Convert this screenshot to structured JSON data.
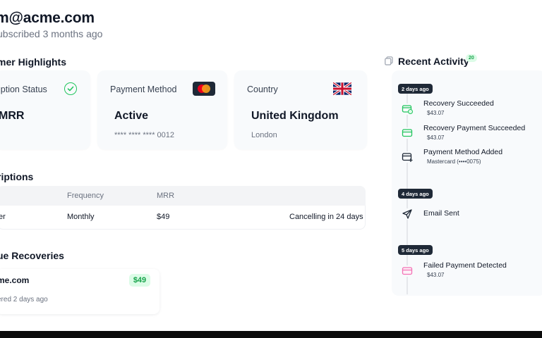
{
  "header": {
    "email": "m@acme.com",
    "subscribed": "ubscribed 3 months ago"
  },
  "highlights": {
    "title": "mer Highlights",
    "cards": [
      {
        "label": "iption Status",
        "value": "MRR",
        "icon": "check-circle-icon"
      },
      {
        "label": "Payment Method",
        "value": "Active",
        "sub": "**** **** **** 0012",
        "icon": "mastercard-icon"
      },
      {
        "label": "Country",
        "value": "United Kingdom",
        "sub": "London",
        "icon": "uk-flag-icon"
      }
    ]
  },
  "subscriptions": {
    "title": "riptions",
    "columns": [
      "Frequency",
      "MRR"
    ],
    "rows": [
      {
        "plan": "er",
        "frequency": "Monthly",
        "mrr": "$49",
        "status": "Cancelling in 24 days"
      }
    ]
  },
  "recoveries": {
    "title": "ue Recoveries",
    "items": [
      {
        "name": "me.com",
        "amount": "$49",
        "date": "ered 2 days ago"
      }
    ]
  },
  "activity": {
    "title": "Recent Activity",
    "count": "20",
    "groups": [
      {
        "day": "2 days ago",
        "items": [
          {
            "title": "Recovery Succeeded",
            "sub": "$43.07",
            "icon": "card-check-icon"
          },
          {
            "title": "Recovery Payment Succeeded",
            "sub": "$43.07",
            "icon": "credit-card-icon"
          },
          {
            "title": "Payment Method Added",
            "sub": "Mastercard (••••0075)",
            "icon": "card-plus-icon"
          }
        ]
      },
      {
        "day": "4 days ago",
        "items": [
          {
            "title": "Email Sent",
            "sub": "",
            "icon": "send-icon"
          }
        ]
      },
      {
        "day": "5 days ago",
        "items": [
          {
            "title": "Failed Payment Detected",
            "sub": "$43.07",
            "icon": "card-failed-icon"
          }
        ]
      }
    ]
  },
  "colors": {
    "accent_green": "#22c55e",
    "badge_green_bg": "#dcfce7",
    "badge_green_text": "#16a34a",
    "dark_pill": "#1f2937",
    "failed_pink": "#f472b6"
  }
}
